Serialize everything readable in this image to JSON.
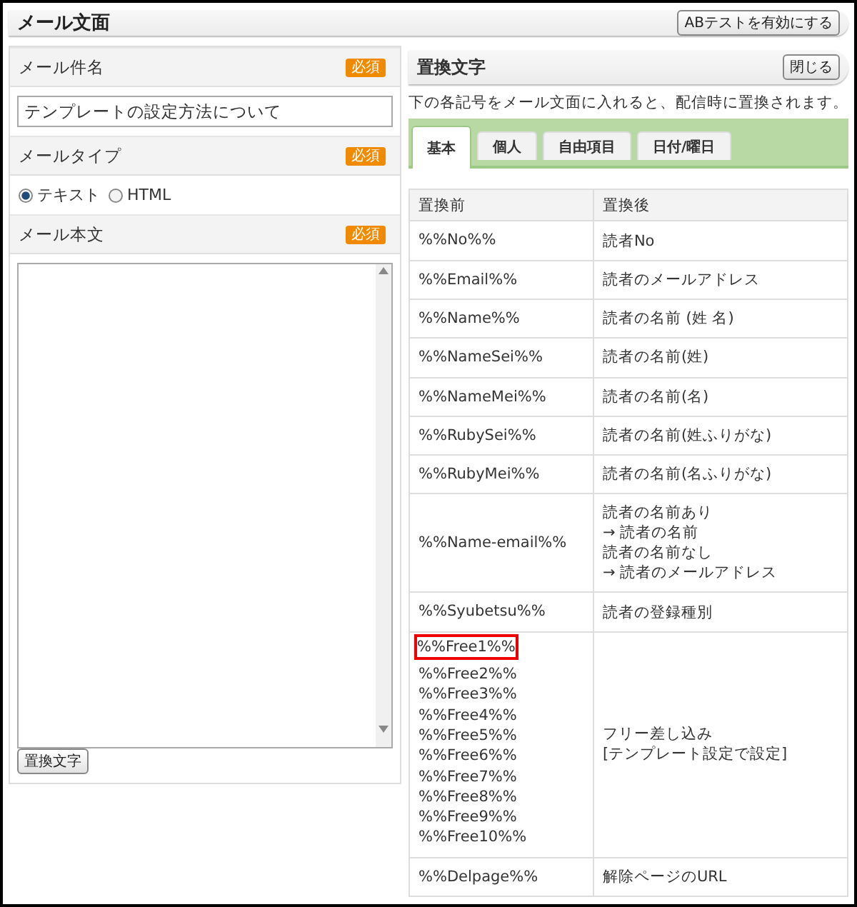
{
  "page": {
    "title": "メール文面",
    "ab_button": "ABテストを有効にする"
  },
  "subject": {
    "label": "メール件名",
    "badge": "必須",
    "value": "テンプレートの設定方法について"
  },
  "mail_type": {
    "label": "メールタイプ",
    "badge": "必須",
    "options": [
      {
        "label": "テキスト",
        "selected": true
      },
      {
        "label": "HTML",
        "selected": false
      }
    ]
  },
  "body": {
    "label": "メール本文",
    "badge": "必須",
    "insert_button": "置換文字"
  },
  "replacements": {
    "title": "置換文字",
    "close_button": "閉じる",
    "description": "下の各記号をメール文面に入れると、配信時に置換されます。",
    "tabs": [
      {
        "label": "基本",
        "selected": true
      },
      {
        "label": "個人",
        "selected": false
      },
      {
        "label": "自由項目",
        "selected": false
      },
      {
        "label": "日付/曜日",
        "selected": false
      }
    ],
    "columns": [
      "置換前",
      "置換後"
    ],
    "rows": [
      {
        "before": [
          {
            "text": "%%No%%",
            "highlighted": false
          }
        ],
        "after": [
          "読者No"
        ]
      },
      {
        "before": [
          {
            "text": "%%Email%%",
            "highlighted": false
          }
        ],
        "after": [
          "読者のメールアドレス"
        ]
      },
      {
        "before": [
          {
            "text": "%%Name%%",
            "highlighted": false
          }
        ],
        "after": [
          "読者の名前 (姓 名)"
        ]
      },
      {
        "before": [
          {
            "text": "%%NameSei%%",
            "highlighted": false
          }
        ],
        "after": [
          "読者の名前(姓)"
        ]
      },
      {
        "before": [
          {
            "text": "%%NameMei%%",
            "highlighted": false
          }
        ],
        "after": [
          "読者の名前(名)"
        ]
      },
      {
        "before": [
          {
            "text": "%%RubySei%%",
            "highlighted": false
          }
        ],
        "after": [
          "読者の名前(姓ふりがな)"
        ]
      },
      {
        "before": [
          {
            "text": "%%RubyMei%%",
            "highlighted": false
          }
        ],
        "after": [
          "読者の名前(名ふりがな)"
        ]
      },
      {
        "before": [
          {
            "text": "%%Name-email%%",
            "highlighted": false
          }
        ],
        "after": [
          "読者の名前あり",
          "→ 読者の名前",
          "読者の名前なし",
          "→ 読者のメールアドレス"
        ]
      },
      {
        "before": [
          {
            "text": "%%Syubetsu%%",
            "highlighted": false
          }
        ],
        "after": [
          "読者の登録種別"
        ]
      },
      {
        "before": [
          {
            "text": "%%Free1%%",
            "highlighted": true
          },
          {
            "text": "%%Free2%%",
            "highlighted": false
          },
          {
            "text": "%%Free3%%",
            "highlighted": false
          },
          {
            "text": "%%Free4%%",
            "highlighted": false
          },
          {
            "text": "%%Free5%%",
            "highlighted": false
          },
          {
            "text": "%%Free6%%",
            "highlighted": false
          },
          {
            "text": "%%Free7%%",
            "highlighted": false
          },
          {
            "text": "%%Free8%%",
            "highlighted": false
          },
          {
            "text": "%%Free9%%",
            "highlighted": false
          },
          {
            "text": "%%Free10%%",
            "highlighted": false
          }
        ],
        "after": [
          "フリー差し込み",
          "[テンプレート設定で設定]"
        ]
      },
      {
        "before": [
          {
            "text": "%%Delpage%%",
            "highlighted": false
          }
        ],
        "after": [
          "解除ページのURL"
        ]
      }
    ]
  }
}
